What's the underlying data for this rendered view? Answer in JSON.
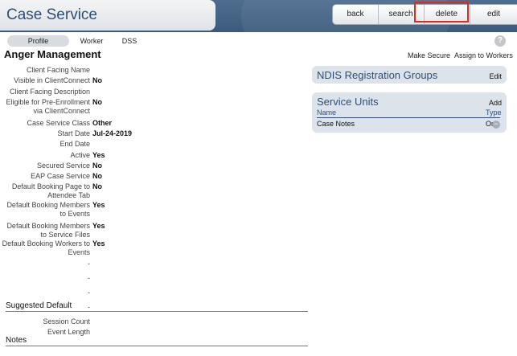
{
  "header": {
    "title": "Case Service",
    "buttons": [
      "back",
      "search",
      "delete",
      "edit"
    ]
  },
  "tabs": [
    "Profile",
    "Worker",
    "DSS"
  ],
  "page_title": "Anger Management",
  "actions": {
    "make_secure": "Make Secure",
    "assign_workers": "Assign to Workers"
  },
  "fields": [
    {
      "label": "Client Facing Name",
      "value": ""
    },
    {
      "label": "Visible in ClientConnect",
      "value": "No"
    },
    {
      "label": "Client Facing Description",
      "value": ""
    },
    {
      "label": "Eligible for Pre-Enrollment via ClientConnect",
      "value": "No"
    },
    {
      "label": "Case Service Class",
      "value": "Other"
    },
    {
      "label": "Start Date",
      "value": "Jul-24-2019"
    },
    {
      "label": "End Date",
      "value": ""
    },
    {
      "label": "Active",
      "value": "Yes"
    },
    {
      "label": "Secured Service",
      "value": "No"
    },
    {
      "label": "EAP Case Service",
      "value": "No"
    },
    {
      "label": "Default Booking Page to Attendee Tab",
      "value": "No"
    },
    {
      "label": "Default Booking Members to Events",
      "value": "Yes"
    },
    {
      "label": "Default Booking Members to Service Files",
      "value": "Yes"
    },
    {
      "label": "Default Booking Workers to Events",
      "value": "Yes"
    },
    {
      "label": "-",
      "value": ""
    },
    {
      "label": "-",
      "value": ""
    },
    {
      "label": "-",
      "value": ""
    },
    {
      "label": "-",
      "value": ""
    }
  ],
  "suggested_default": {
    "title": "Suggested Default",
    "fields": [
      {
        "label": "Session Count",
        "value": ""
      },
      {
        "label": "Event Length",
        "value": ""
      }
    ]
  },
  "notes": {
    "title": "Notes"
  },
  "ndis": {
    "title": "NDIS Registration Groups",
    "action": "Edit"
  },
  "service_units": {
    "title": "Service Units",
    "action": "Add",
    "columns": [
      "Name",
      "Type"
    ],
    "rows": [
      {
        "name": "Case Notes",
        "type": "Org"
      }
    ]
  },
  "colors": {
    "accent": "#2f4f76",
    "highlight": "#e3281c"
  }
}
